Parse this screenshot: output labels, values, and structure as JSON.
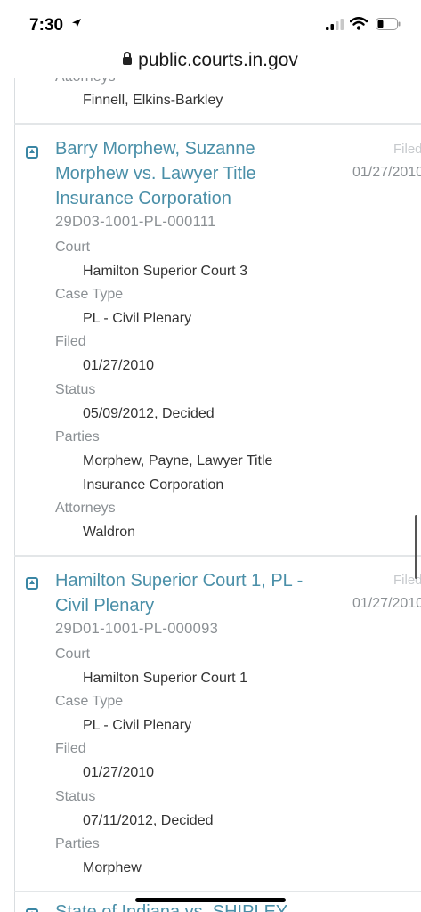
{
  "status_bar": {
    "time": "7:30"
  },
  "url_bar": {
    "url": "public.courts.in.gov"
  },
  "prev_case": {
    "label_attorneys": "Attorneys",
    "attorneys": "Finnell, Elkins-Barkley"
  },
  "cases": [
    {
      "title_line1": "Barry Morphew, Suzanne",
      "title_line2": "Morphew vs. Lawyer Title",
      "title_line3": "Insurance Corporation",
      "case_number": "29D03-1001-PL-000111",
      "filed_label": "Filed",
      "filed_date": "01/27/2010",
      "court_label": "Court",
      "court": "Hamilton Superior Court 3",
      "case_type_label": "Case Type",
      "case_type": "PL - Civil Plenary",
      "filed_field_label": "Filed",
      "filed": "01/27/2010",
      "status_label": "Status",
      "status": "05/09/2012, Decided",
      "parties_label": "Parties",
      "parties_line1": "Morphew, Payne, Lawyer Title",
      "parties_line2": "Insurance Corporation",
      "attorneys_label": "Attorneys",
      "attorneys": "Waldron"
    },
    {
      "title_line1": "Hamilton Superior Court 1, PL -",
      "title_line2": "Civil Plenary",
      "case_number": "29D01-1001-PL-000093",
      "filed_label": "Filed",
      "filed_date": "01/27/2010",
      "court_label": "Court",
      "court": "Hamilton Superior Court 1",
      "case_type_label": "Case Type",
      "case_type": "PL - Civil Plenary",
      "filed_field_label": "Filed",
      "filed": "01/27/2010",
      "status_label": "Status",
      "status": "07/11/2012, Decided",
      "parties_label": "Parties",
      "parties": "Morphew"
    }
  ],
  "next_case": {
    "title_partial": "State of Indiana vs. SHIPLEY"
  }
}
